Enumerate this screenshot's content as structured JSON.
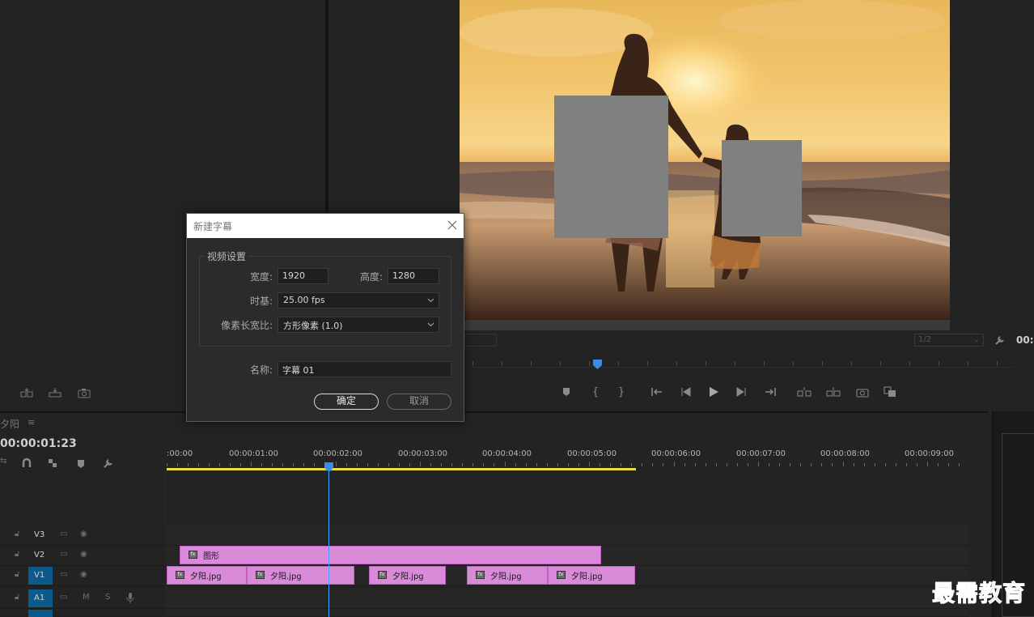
{
  "dialog": {
    "title": "新建字幕",
    "group_label": "视频设置",
    "width_label": "宽度:",
    "width_value": "1920",
    "height_label": "高度:",
    "height_value": "1280",
    "timebase_label": "时基:",
    "timebase_value": "25.00 fps",
    "pixel_aspect_label": "像素长宽比:",
    "pixel_aspect_value": "方形像素 (1.0)",
    "name_label": "名称:",
    "name_value": "字幕 01",
    "ok_label": "确定",
    "cancel_label": "取消"
  },
  "program_monitor": {
    "resolution": "1/2",
    "timecode": "00:"
  },
  "sequence": {
    "title": "夕阳",
    "menu_icon": "≡",
    "timecode": "00:00:01:23"
  },
  "ruler": {
    "labels": [
      ":00:00",
      "00:00:01:00",
      "00:00:02:00",
      "00:00:03:00",
      "00:00:04:00",
      "00:00:05:00",
      "00:00:06:00",
      "00:00:07:00",
      "00:00:08:00",
      "00:00:09:00"
    ]
  },
  "tracks": {
    "v3": "V3",
    "v2": "V2",
    "v1": "V1",
    "a1": "A1",
    "mute": "M",
    "solo": "S"
  },
  "clips": {
    "graphic": "图形",
    "image1": "夕阳.jpg",
    "image2": "夕阳.jpg",
    "image3": "夕阳.jpg",
    "image4": "夕阳.jpg",
    "image5": "夕阳.jpg"
  },
  "colors": {
    "clip": "#d98ad9",
    "track_target": "#0b5a8c",
    "playhead": "#4aa0ff",
    "work_area": "#e7dc3a"
  },
  "watermark": "最需教育"
}
